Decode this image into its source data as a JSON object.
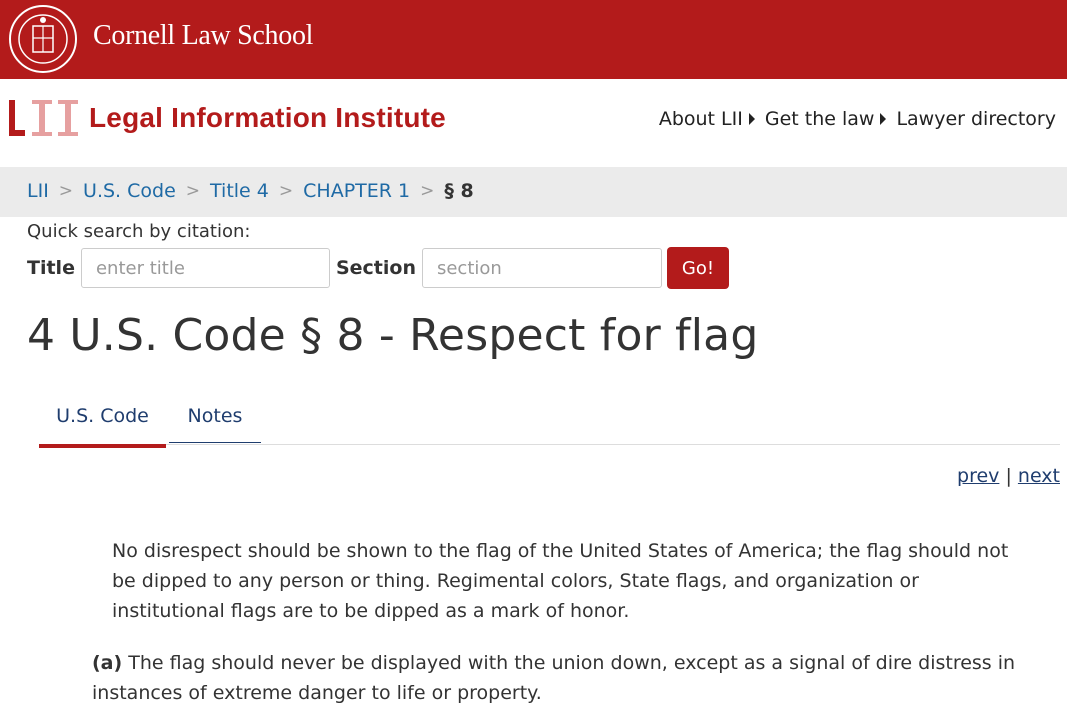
{
  "brand": {
    "school_name": "Cornell Law School",
    "institute_name": "Legal Information Institute",
    "colors": {
      "cornell_red": "#b31b1b",
      "link_blue": "#1f6aa5",
      "nav_navy": "#1f3d6e"
    }
  },
  "topnav": {
    "items": [
      {
        "label": "About LII",
        "icon": "caret-right-icon"
      },
      {
        "label": "Get the law",
        "icon": "caret-right-icon"
      },
      {
        "label": "Lawyer directory"
      }
    ]
  },
  "breadcrumb": {
    "items": [
      "LII",
      "U.S. Code",
      "Title 4",
      "CHAPTER 1"
    ],
    "separator": ">",
    "current": "§ 8"
  },
  "quick_search": {
    "label": "Quick search by citation:",
    "title_label": "Title",
    "title_placeholder": "enter title",
    "section_label": "Section",
    "section_placeholder": "section",
    "go_label": "Go!"
  },
  "page_title": "4 U.S. Code § 8 - Respect for flag",
  "tabs": [
    {
      "label": "U.S. Code",
      "active": true
    },
    {
      "label": "Notes",
      "active": false
    }
  ],
  "pager": {
    "prev": "prev",
    "divider": "|",
    "next": "next"
  },
  "content": {
    "intro": "No disrespect should be shown to the flag of the United States of America; the flag should not be dipped to any person or thing. Regimental colors, State flags, and organization or institutional flags are to be dipped as a mark of honor.",
    "para_a_marker": "(a)",
    "para_a_text": " The flag should never be displayed with the union down, except as a signal of dire distress in instances of extreme danger to life or property."
  }
}
